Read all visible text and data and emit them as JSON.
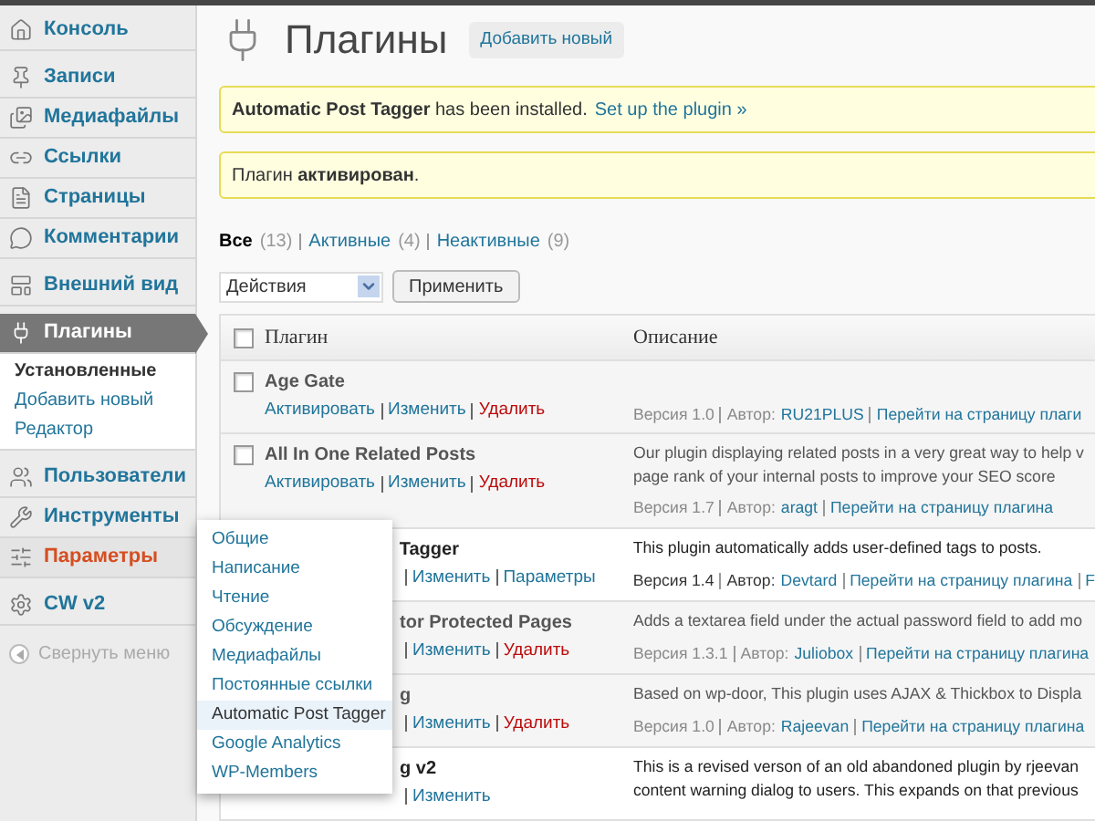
{
  "sidebar": {
    "items": [
      {
        "label": "Консоль",
        "selected": false,
        "hovered": false
      },
      {
        "label": "Записи",
        "selected": false,
        "hovered": false
      },
      {
        "label": "Медиафайлы",
        "selected": false,
        "hovered": false
      },
      {
        "label": "Ссылки",
        "selected": false,
        "hovered": false
      },
      {
        "label": "Страницы",
        "selected": false,
        "hovered": false
      },
      {
        "label": "Комментарии",
        "selected": false,
        "hovered": false
      },
      {
        "label": "Внешний вид",
        "selected": false,
        "hovered": false
      },
      {
        "label": "Плагины",
        "selected": true,
        "hovered": false,
        "children": [
          {
            "label": "Установленные",
            "selected": true
          },
          {
            "label": "Добавить новый",
            "selected": false
          },
          {
            "label": "Редактор",
            "selected": false
          }
        ]
      },
      {
        "label": "Пользователи",
        "selected": false,
        "hovered": false
      },
      {
        "label": "Инструменты",
        "selected": false,
        "hovered": false
      },
      {
        "label": "Параметры",
        "selected": false,
        "hovered": true,
        "children": [
          {
            "label": "Общие",
            "selected": false
          },
          {
            "label": "Написание",
            "selected": false
          },
          {
            "label": "Чтение",
            "selected": false
          },
          {
            "label": "Обсуждение",
            "selected": false
          },
          {
            "label": "Медиафайлы",
            "selected": false
          },
          {
            "label": "Постоянные ссылки",
            "selected": false
          },
          {
            "label": "Automatic Post Tagger",
            "selected": true
          },
          {
            "label": "Google Analytics",
            "selected": false
          },
          {
            "label": "WP-Members",
            "selected": false
          }
        ]
      },
      {
        "label": "CW v2",
        "selected": false,
        "hovered": false
      }
    ],
    "collapse": "Свернуть меню"
  },
  "page": {
    "title": "Плагины",
    "add_new": "Добавить новый"
  },
  "notices": [
    {
      "text": "**Automatic Post Tagger** has been installed.",
      "link": "Set up the plugin »"
    },
    {
      "text": "Плагин **активирован**."
    }
  ],
  "filters": [
    {
      "label": "Все",
      "count": "(13)",
      "selected": true
    },
    {
      "label": "Активные",
      "count": "(4)",
      "selected": false
    },
    {
      "label": "Неактивные",
      "count": "(9)",
      "selected": false
    }
  ],
  "bulk": {
    "select": "Действия",
    "apply": "Применить"
  },
  "table": {
    "columns": [
      "Плагин",
      "Описание"
    ],
    "header_checked": false,
    "rows": [
      {
        "name": "Age Gate",
        "active": false,
        "checked": false,
        "actions": [
          {
            "label": "Активировать",
            "kind": "link"
          },
          {
            "label": "Изменить",
            "kind": "link"
          },
          {
            "label": "Удалить",
            "kind": "delete"
          }
        ],
        "description": [],
        "version": "Версия 1.0",
        "author_label": "Автор:",
        "author": "RU21PLUS",
        "links": [
          "Перейти на страницу плаги"
        ]
      },
      {
        "name": "All In One Related Posts",
        "active": false,
        "checked": false,
        "actions": [
          {
            "label": "Активировать",
            "kind": "link"
          },
          {
            "label": "Изменить",
            "kind": "link"
          },
          {
            "label": "Удалить",
            "kind": "delete"
          }
        ],
        "description": [
          "Our plugin displaying related posts in a very great way to help v",
          "page rank of your internal posts to improve your SEO score"
        ],
        "version": "Версия 1.7",
        "author_label": "Автор:",
        "author": "aragt",
        "links": [
          "Перейти на страницу плагина"
        ]
      },
      {
        "name": "Tagger",
        "active": true,
        "actions": [
          {
            "label": "Изменить",
            "kind": "link"
          },
          {
            "label": "Параметры",
            "kind": "link"
          }
        ],
        "description": [
          "This plugin automatically adds user-defined tags to posts."
        ],
        "version": "Версия 1.4",
        "author_label": "Автор:",
        "author": "Devtard",
        "links": [
          "Перейти на страницу плагина",
          "F"
        ]
      },
      {
        "name": "tor Protected Pages",
        "active": false,
        "actions": [
          {
            "label": "Изменить",
            "kind": "link"
          },
          {
            "label": "Удалить",
            "kind": "delete"
          }
        ],
        "description": [
          "Adds a textarea field under the actual password field to add mo"
        ],
        "version": "Версия 1.3.1",
        "author_label": "Автор:",
        "author": "Juliobox",
        "links": [
          "Перейти на страницу плагина"
        ]
      },
      {
        "name": "g",
        "active": false,
        "actions": [
          {
            "label": "Изменить",
            "kind": "link"
          },
          {
            "label": "Удалить",
            "kind": "delete"
          }
        ],
        "description": [
          "Based on wp-door, This plugin uses AJAX & Thickbox to Displa"
        ],
        "version": "Версия 1.0",
        "author_label": "Автор:",
        "author": "Rajeevan",
        "links": [
          "Перейти на страницу плагина"
        ]
      },
      {
        "name": "g v2",
        "active": true,
        "actions": [
          {
            "label": "Изменить",
            "kind": "link"
          }
        ],
        "description": [
          "This is a revised verson of an old abandoned plugin by rjeevan",
          "content warning dialog to users. This expands on that previous"
        ]
      }
    ]
  }
}
